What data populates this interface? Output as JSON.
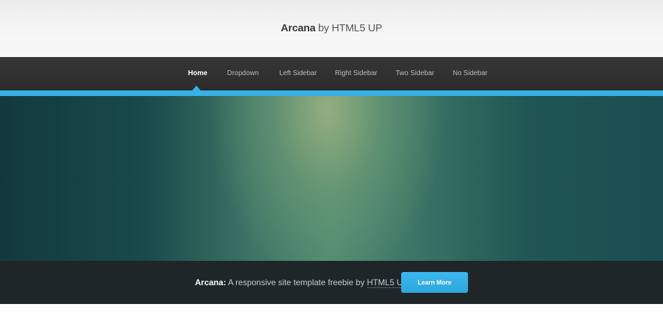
{
  "header": {
    "brand": "Arcana",
    "by_text": "by HTML5 UP"
  },
  "nav": {
    "items": [
      {
        "label": "Home",
        "active": true
      },
      {
        "label": "Dropdown",
        "active": false
      },
      {
        "label": "Left Sidebar",
        "active": false
      },
      {
        "label": "Right Sidebar",
        "active": false
      },
      {
        "label": "Two Sidebar",
        "active": false
      },
      {
        "label": "No Sidebar",
        "active": false
      }
    ]
  },
  "cta": {
    "brand": "Arcana:",
    "text": " A responsive site template freebie by ",
    "link": "HTML5 UP",
    "button": "Learn More"
  },
  "colors": {
    "accent": "#37b0e8",
    "nav_bg": "#2f2f2f",
    "cta_bg": "#1e2628"
  }
}
